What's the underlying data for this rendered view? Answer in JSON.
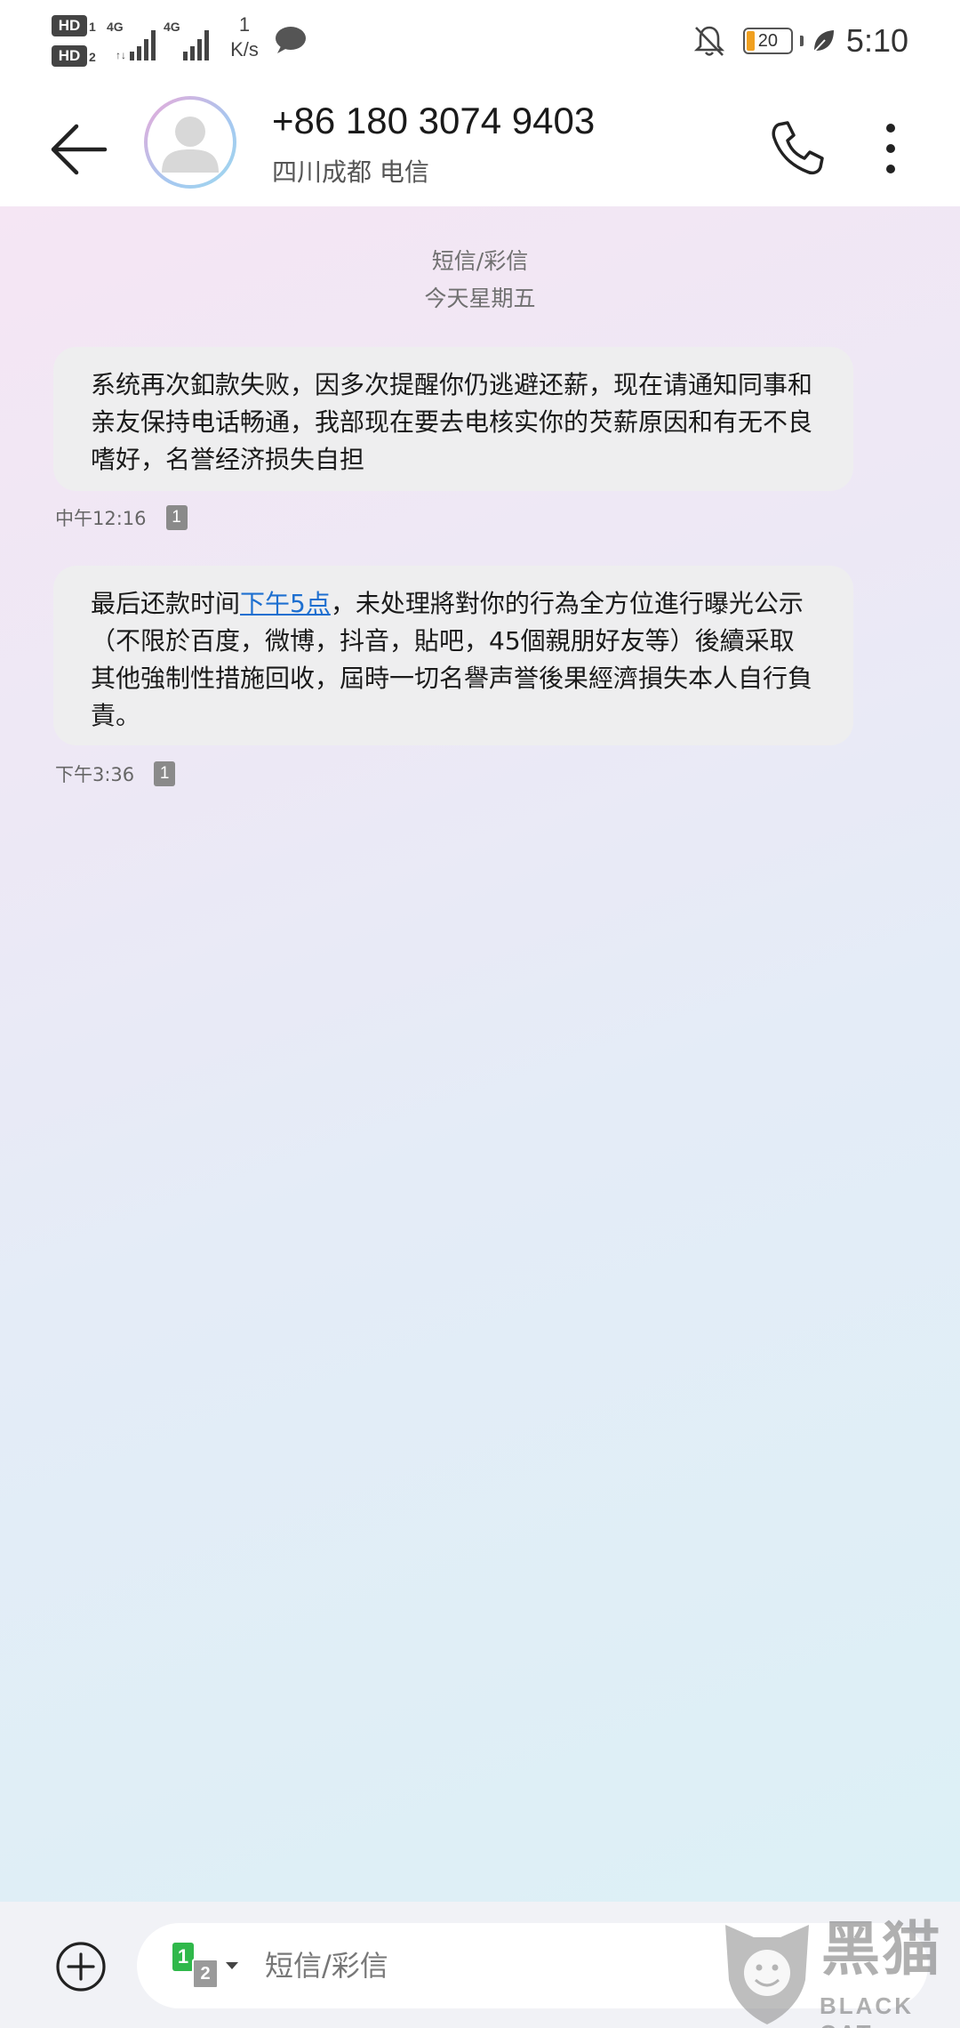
{
  "status_bar": {
    "sim1_badge": "HD",
    "sim1_num": "1",
    "sim2_badge": "HD",
    "sim2_num": "2",
    "net1": "4G",
    "net2": "4G",
    "speed_value": "1",
    "speed_unit": "K/s",
    "battery_level": "20",
    "time": "5:10",
    "icons": [
      "hd-badge",
      "signal-bars",
      "chat-bubble-icon",
      "bell-off-icon",
      "battery-icon",
      "leaf-icon"
    ]
  },
  "header": {
    "contact_number": "+86 180 3074 9403",
    "contact_location": "四川成都 电信",
    "icons": [
      "back-arrow-icon",
      "avatar-icon",
      "phone-icon",
      "more-icon"
    ]
  },
  "conversation": {
    "type_label": "短信/彩信",
    "date_label": "今天星期五",
    "messages": [
      {
        "text": "系统再次釦款失败，因多次提醒你仍逃避还薪，现在请通知同事和亲友保持电话畅通，我部现在要去电核实你的芡薪原因和有无不良嗜好，名誉经济损失自担",
        "time": "中午12:16",
        "sim": "1"
      },
      {
        "text_before": "最后还款时间",
        "link_text": "下午5点",
        "text_after": "，未处理將對你的行為全方位進行曝光公示（不限於百度，微博，抖音，貼吧，45個親朋好友等）後續采取其他強制性措施回收，屆時一切名譽声誉後果經濟損失本人自行負責。",
        "time": "下午3:36",
        "sim": "1"
      }
    ]
  },
  "input_bar": {
    "sim_primary": "1",
    "sim_secondary": "2",
    "placeholder": "短信/彩信",
    "icons": [
      "add-icon",
      "sim-switch-icon"
    ]
  },
  "watermark": {
    "cn": "黑猫",
    "en": "BLACK CAT"
  },
  "colors": {
    "link": "#1d6fd0",
    "bubble": "#eeeeef",
    "battery_fill": "#f0a020",
    "sim1_green": "#2fb84a"
  }
}
